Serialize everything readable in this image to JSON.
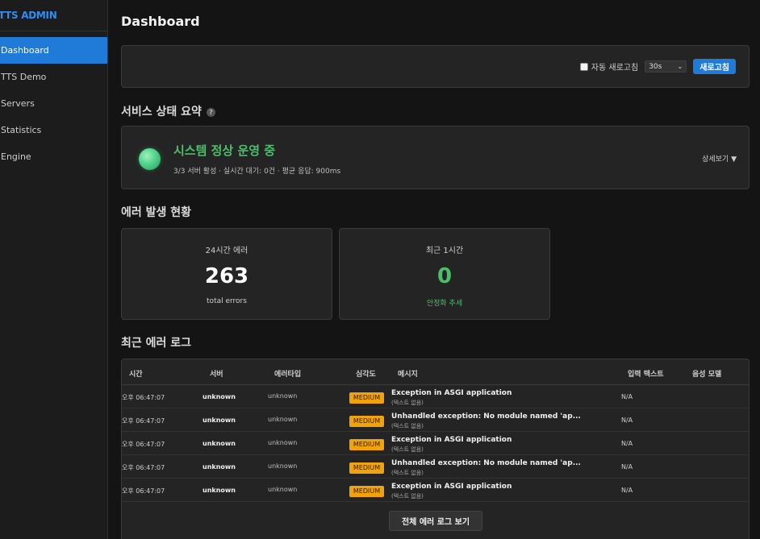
{
  "sidebar": {
    "brand": "TTS ADMIN",
    "items": [
      {
        "label": "Dashboard",
        "active": true
      },
      {
        "label": "TTS Demo",
        "active": false
      },
      {
        "label": "Servers",
        "active": false
      },
      {
        "label": "Statistics",
        "active": false
      },
      {
        "label": "Engine",
        "active": false
      }
    ]
  },
  "header": {
    "title": "Dashboard"
  },
  "toolbar": {
    "auto_refresh_label": "자동 새로고침",
    "auto_refresh_checked": false,
    "interval_value": "30s",
    "refresh_button": "새로고침"
  },
  "status_section": {
    "title": "서비스 상태 요약",
    "help_icon": "?",
    "headline": "시스템 정상 운영 중",
    "summary": "3/3 서버 활성 · 실시간 대기: 0건 · 평균 응답: 900ms",
    "detail_toggle": "상세보기 ▼",
    "status_color": "#4cbf6a"
  },
  "errors_section": {
    "title": "에러 발생 현황",
    "cards": [
      {
        "label": "24시간 에러",
        "value": "263",
        "sub": "total errors"
      },
      {
        "label": "최근 1시간",
        "value": "0",
        "sub": "안정화 추세"
      }
    ]
  },
  "log_section": {
    "title": "최근 에러 로그",
    "columns": [
      "시간",
      "서버",
      "에러타입",
      "심각도",
      "메시지",
      "입력 텍스트",
      "음성 모델"
    ],
    "rows": [
      {
        "time": "오후 06:47:07",
        "server": "unknown",
        "type": "unknown",
        "severity": "MEDIUM",
        "message": "Exception in ASGI application",
        "message_sub": "(텍스트 없음)",
        "input": "N/A",
        "model": ""
      },
      {
        "time": "오후 06:47:07",
        "server": "unknown",
        "type": "unknown",
        "severity": "MEDIUM",
        "message": "Unhandled exception: No module named 'ap...",
        "message_sub": "(텍스트 없음)",
        "input": "N/A",
        "model": ""
      },
      {
        "time": "오후 06:47:07",
        "server": "unknown",
        "type": "unknown",
        "severity": "MEDIUM",
        "message": "Exception in ASGI application",
        "message_sub": "(텍스트 없음)",
        "input": "N/A",
        "model": ""
      },
      {
        "time": "오후 06:47:07",
        "server": "unknown",
        "type": "unknown",
        "severity": "MEDIUM",
        "message": "Unhandled exception: No module named 'ap...",
        "message_sub": "(텍스트 없음)",
        "input": "N/A",
        "model": ""
      },
      {
        "time": "오후 06:47:07",
        "server": "unknown",
        "type": "unknown",
        "severity": "MEDIUM",
        "message": "Exception in ASGI application",
        "message_sub": "(텍스트 없음)",
        "input": "N/A",
        "model": ""
      }
    ],
    "view_all_button": "전체 에러 로그 보기"
  },
  "colors": {
    "accent": "#1f7ad8",
    "severity_medium": "#f0a30a",
    "success": "#4cbf6a"
  }
}
